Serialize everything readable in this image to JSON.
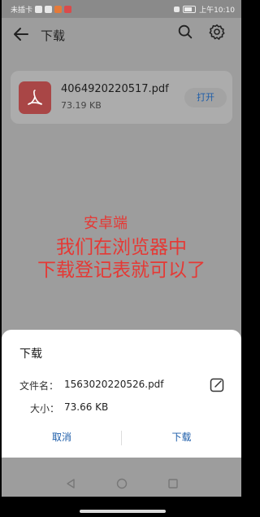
{
  "status_bar": {
    "left_text": "未插卡",
    "time_text": "上午10:10"
  },
  "header": {
    "title": "下载",
    "icons": [
      "back-arrow-icon",
      "search-icon",
      "gear-icon"
    ]
  },
  "download_card": {
    "file_name": "4064920220517.pdf",
    "file_size": "73.19 KB",
    "open_label": "打开",
    "icon": "pdf-icon"
  },
  "overlay": {
    "line_small": "安卓端",
    "line_big_1": "我们在浏览器中",
    "line_big_2": "下载登记表就可以了",
    "color": "#e53935"
  },
  "dialog": {
    "title": "下载",
    "file_name_label": "文件名：",
    "file_name_value": "1563020220526.pdf",
    "size_label": "大小：",
    "size_value": "73.66 KB",
    "cancel_label": "取消",
    "download_label": "下载",
    "accent": "#1d5da9"
  },
  "nav_bar": {
    "icons": [
      "nav-back-icon",
      "nav-home-icon",
      "nav-recents-icon"
    ]
  }
}
